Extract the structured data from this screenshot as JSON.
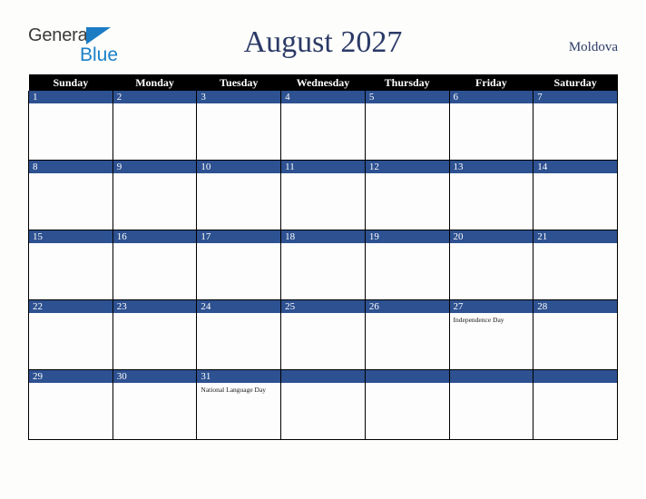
{
  "brand": {
    "name_top": "General",
    "name_bottom": "Blue",
    "triangle_icon": "triangle-icon",
    "color_top": "#3a3a3a",
    "color_bottom": "#1b80c8"
  },
  "header": {
    "title": "August 2027",
    "region": "Moldova",
    "title_color": "#2b3a67"
  },
  "colors": {
    "header_bar": "#000000",
    "date_banner": "#2d5191",
    "cell_background": "#fdfdfd",
    "page_background": "#fdfdfb",
    "grid_border": "#000000"
  },
  "weekdays": [
    "Sunday",
    "Monday",
    "Tuesday",
    "Wednesday",
    "Thursday",
    "Friday",
    "Saturday"
  ],
  "weeks": [
    [
      {
        "date": "1",
        "events": []
      },
      {
        "date": "2",
        "events": []
      },
      {
        "date": "3",
        "events": []
      },
      {
        "date": "4",
        "events": []
      },
      {
        "date": "5",
        "events": []
      },
      {
        "date": "6",
        "events": []
      },
      {
        "date": "7",
        "events": []
      }
    ],
    [
      {
        "date": "8",
        "events": []
      },
      {
        "date": "9",
        "events": []
      },
      {
        "date": "10",
        "events": []
      },
      {
        "date": "11",
        "events": []
      },
      {
        "date": "12",
        "events": []
      },
      {
        "date": "13",
        "events": []
      },
      {
        "date": "14",
        "events": []
      }
    ],
    [
      {
        "date": "15",
        "events": []
      },
      {
        "date": "16",
        "events": []
      },
      {
        "date": "17",
        "events": []
      },
      {
        "date": "18",
        "events": []
      },
      {
        "date": "19",
        "events": []
      },
      {
        "date": "20",
        "events": []
      },
      {
        "date": "21",
        "events": []
      }
    ],
    [
      {
        "date": "22",
        "events": []
      },
      {
        "date": "23",
        "events": []
      },
      {
        "date": "24",
        "events": []
      },
      {
        "date": "25",
        "events": []
      },
      {
        "date": "26",
        "events": []
      },
      {
        "date": "27",
        "events": [
          "Independence Day"
        ]
      },
      {
        "date": "28",
        "events": []
      }
    ],
    [
      {
        "date": "29",
        "events": []
      },
      {
        "date": "30",
        "events": []
      },
      {
        "date": "31",
        "events": [
          "National Language Day"
        ]
      },
      {
        "date": "",
        "events": []
      },
      {
        "date": "",
        "events": []
      },
      {
        "date": "",
        "events": []
      },
      {
        "date": "",
        "events": []
      }
    ]
  ]
}
